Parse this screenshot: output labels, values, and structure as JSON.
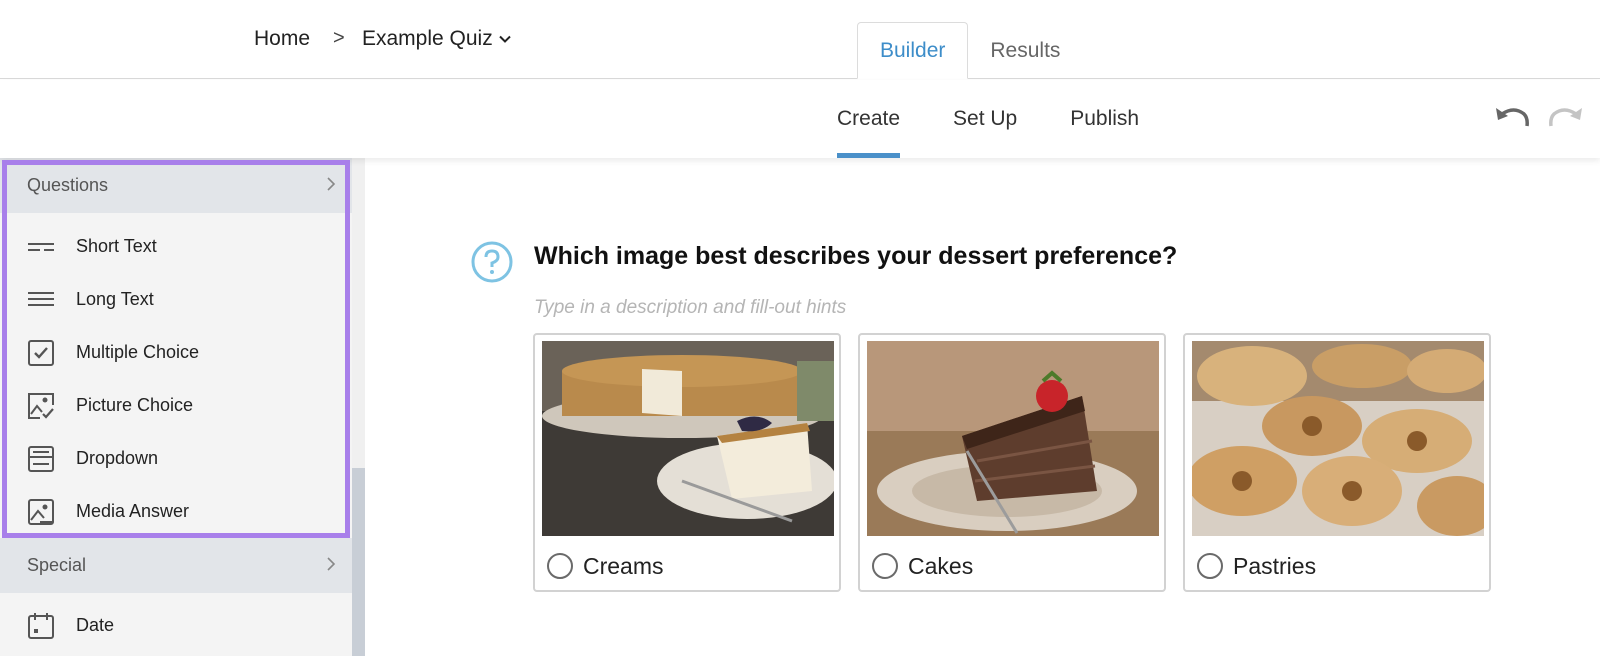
{
  "breadcrumb": {
    "home": "Home",
    "separator": ">",
    "quiz": "Example Quiz"
  },
  "top_tabs": [
    {
      "label": "Builder",
      "active": true
    },
    {
      "label": "Results",
      "active": false
    }
  ],
  "sub_tabs": [
    {
      "label": "Create",
      "active": true
    },
    {
      "label": "Set Up",
      "active": false
    },
    {
      "label": "Publish",
      "active": false
    }
  ],
  "toolbar": {
    "undo_icon": "undo-icon",
    "redo_icon": "redo-icon"
  },
  "sidebar": {
    "sections": [
      {
        "title": "Questions",
        "items": [
          {
            "label": "Short Text",
            "icon": "short-text-icon"
          },
          {
            "label": "Long Text",
            "icon": "long-text-icon"
          },
          {
            "label": "Multiple Choice",
            "icon": "checkbox-icon"
          },
          {
            "label": "Picture Choice",
            "icon": "picture-choice-icon"
          },
          {
            "label": "Dropdown",
            "icon": "dropdown-icon"
          },
          {
            "label": "Media Answer",
            "icon": "media-answer-icon"
          }
        ]
      },
      {
        "title": "Special",
        "items": [
          {
            "label": "Date",
            "icon": "calendar-icon"
          }
        ]
      }
    ]
  },
  "question": {
    "title": "Which image best describes your dessert preference?",
    "hint_placeholder": "Type in a description and fill-out hints",
    "choices": [
      {
        "label": "Creams"
      },
      {
        "label": "Cakes"
      },
      {
        "label": "Pastries"
      }
    ]
  },
  "colors": {
    "accent": "#4a90c9",
    "highlight": "#a87fea",
    "question_icon": "#7ec3e3"
  }
}
